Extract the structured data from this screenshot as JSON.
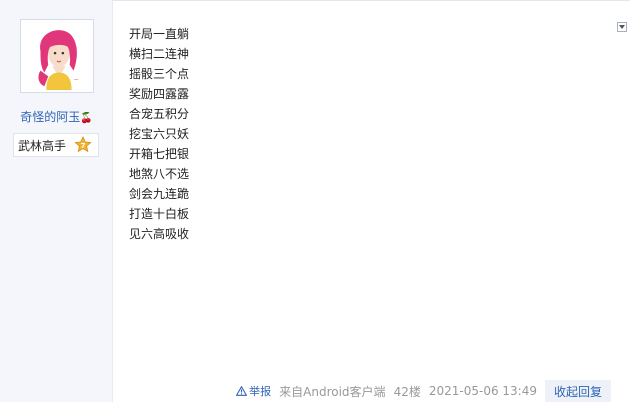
{
  "user": {
    "name": "奇怪的阿玉",
    "name_suffix_icon": "cherry-icon",
    "rank_title": "武林高手",
    "rank_level": "7"
  },
  "post": {
    "lines": [
      "开局一直躺",
      "横扫二连神",
      "摇骰三个点",
      "奖励四露露",
      "合宠五积分",
      "挖宝六只妖",
      "开箱七把银",
      "地煞八不选",
      "剑会九连跪",
      "打造十白板",
      "见六高吸收"
    ]
  },
  "footer": {
    "report_label": "举报",
    "source": "来自Android客户端",
    "floor": "42楼",
    "timestamp": "2021-05-06 13:49",
    "reply_label": "收起回复"
  },
  "colors": {
    "link": "#2e64b5",
    "sidebar_bg": "#f4f6fb",
    "muted": "#999999"
  }
}
